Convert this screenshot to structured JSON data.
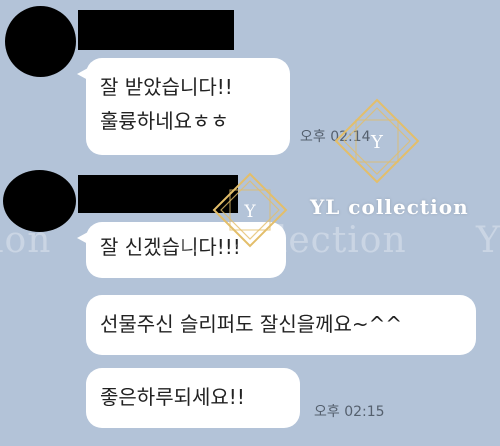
{
  "chat": {
    "messages": [
      {
        "text": "잘 받았습니다!!"
      },
      {
        "text": "훌륭하네요ㅎㅎ"
      },
      {
        "text": "잘 신겠습니다!!!"
      },
      {
        "text": "선물주신 슬리퍼도 잘신을께요~^^"
      },
      {
        "text": "좋은하루되세요!!"
      }
    ],
    "times": {
      "first": "오후 02:14",
      "second": "오후 02:15"
    }
  },
  "watermark": {
    "brand": "YL collection",
    "background_text": "YL Collection",
    "fragment_left": "ion",
    "fragment_right": "Y",
    "logo_letter": "Y",
    "logo_color": "#e3be6a"
  },
  "colors": {
    "background": "#b3c3d8",
    "bubble": "#ffffff",
    "redaction": "#000000"
  }
}
